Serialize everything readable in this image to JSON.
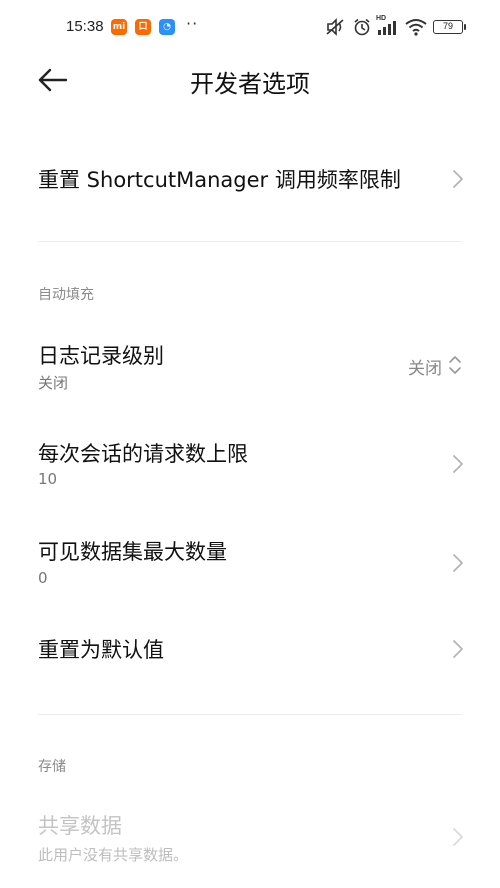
{
  "status_bar": {
    "time": "15:38",
    "battery": "79",
    "notif_icons": [
      {
        "name": "mi-app-icon",
        "label": "mi",
        "color": "#ff6a00"
      },
      {
        "name": "notification-app-icon",
        "label": "口",
        "color": "#ff6a00"
      },
      {
        "name": "chat-app-icon",
        "label": "◔",
        "color": "#2b90ff"
      }
    ],
    "more": "··",
    "hd_label": "HD"
  },
  "header": {
    "title": "开发者选项",
    "back_icon": "back-arrow-icon"
  },
  "rows": {
    "reset_shortcut": {
      "title": "重置 ShortcutManager 调用频率限制"
    },
    "log_level": {
      "title": "日志记录级别",
      "subtitle": "关闭",
      "value": "关闭"
    },
    "max_requests": {
      "title": "每次会话的请求数上限",
      "subtitle": "10"
    },
    "max_datasets": {
      "title": "可见数据集最大数量",
      "subtitle": "0"
    },
    "reset_default": {
      "title": "重置为默认值"
    },
    "shared_data": {
      "title": "共享数据",
      "subtitle": "此用户没有共享数据。"
    }
  },
  "sections": {
    "autofill": "自动填充",
    "storage": "存储"
  },
  "colors": {
    "text_primary": "#111111",
    "text_secondary": "#777777",
    "disabled": "#c4c4c4",
    "divider": "#ececec"
  }
}
